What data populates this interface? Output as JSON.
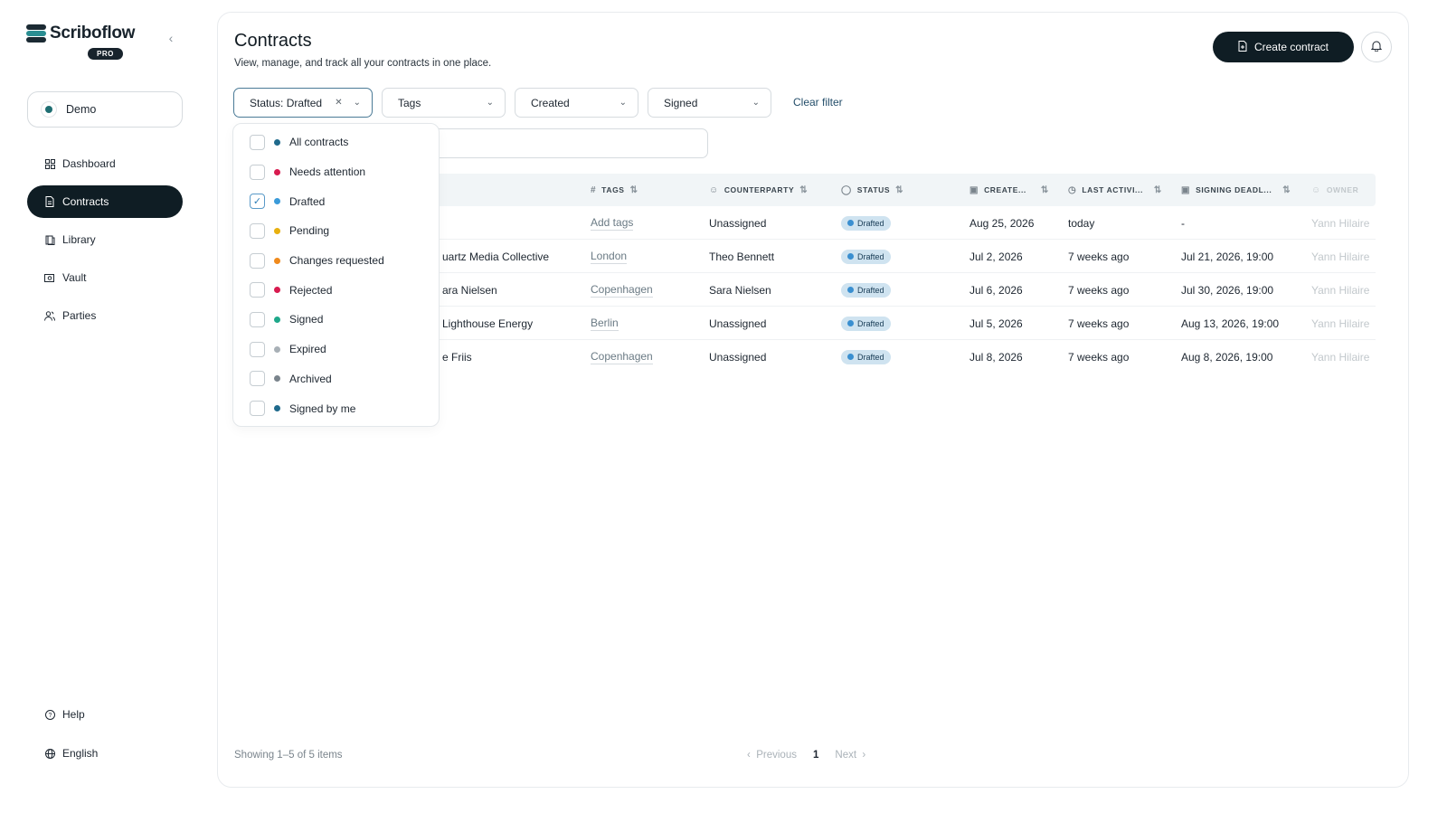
{
  "brand": {
    "name": "Scriboflow",
    "badge": "PRO"
  },
  "workspace": {
    "name": "Demo"
  },
  "nav": [
    {
      "label": "Dashboard",
      "icon": "grid-icon",
      "active": false
    },
    {
      "label": "Contracts",
      "icon": "document-icon",
      "active": true
    },
    {
      "label": "Library",
      "icon": "book-icon",
      "active": false
    },
    {
      "label": "Vault",
      "icon": "vault-icon",
      "active": false
    },
    {
      "label": "Parties",
      "icon": "users-icon",
      "active": false
    }
  ],
  "nav_bottom": [
    {
      "label": "Help",
      "icon": "help-icon"
    },
    {
      "label": "English",
      "icon": "globe-icon"
    }
  ],
  "header": {
    "title": "Contracts",
    "subtitle": "View, manage, and track all your contracts in one place.",
    "create_label": "Create contract"
  },
  "filters": {
    "status": "Status: Drafted",
    "tags": "Tags",
    "created": "Created",
    "signed": "Signed",
    "clear": "Clear filter"
  },
  "status_options": [
    {
      "label": "All contracts",
      "color": "#1f6a8c",
      "checked": false
    },
    {
      "label": "Needs attention",
      "color": "#d81b4f",
      "checked": false
    },
    {
      "label": "Drafted",
      "color": "#3a9ad9",
      "checked": true
    },
    {
      "label": "Pending",
      "color": "#e8b00f",
      "checked": false
    },
    {
      "label": "Changes requested",
      "color": "#f08a1c",
      "checked": false
    },
    {
      "label": "Rejected",
      "color": "#d81b4f",
      "checked": false
    },
    {
      "label": "Signed",
      "color": "#1fa88a",
      "checked": false
    },
    {
      "label": "Expired",
      "color": "#a8b0b6",
      "checked": false
    },
    {
      "label": "Archived",
      "color": "#7a848c",
      "checked": false
    },
    {
      "label": "Signed by me",
      "color": "#1f6a8c",
      "checked": false
    }
  ],
  "columns": {
    "tags": "TAGS",
    "counterparty": "COUNTERPARTY",
    "status": "STATUS",
    "created": "CREATE...",
    "last_activity": "LAST ACTIVI...",
    "signing_deadline": "SIGNING DEADL...",
    "owner": "OWNER"
  },
  "rows": [
    {
      "name": "",
      "tags": "Add tags",
      "counterparty": "Unassigned",
      "status": "Drafted",
      "created": "Aug 25, 2026",
      "last": "today",
      "deadline": "-",
      "owner": "Yann Hilaire"
    },
    {
      "name": "uartz Media Collective",
      "tags": "London",
      "counterparty": "Theo Bennett",
      "status": "Drafted",
      "created": "Jul 2, 2026",
      "last": "7 weeks ago",
      "deadline": "Jul 21, 2026, 19:00",
      "owner": "Yann Hilaire"
    },
    {
      "name": "ara Nielsen",
      "tags": "Copenhagen",
      "counterparty": "Sara Nielsen",
      "status": "Drafted",
      "created": "Jul 6, 2026",
      "last": "7 weeks ago",
      "deadline": "Jul 30, 2026, 19:00",
      "owner": "Yann Hilaire"
    },
    {
      "name": "Lighthouse Energy",
      "tags": "Berlin",
      "counterparty": "Unassigned",
      "status": "Drafted",
      "created": "Jul 5, 2026",
      "last": "7 weeks ago",
      "deadline": "Aug 13, 2026, 19:00",
      "owner": "Yann Hilaire"
    },
    {
      "name": "e Friis",
      "tags": "Copenhagen",
      "counterparty": "Unassigned",
      "status": "Drafted",
      "created": "Jul 8, 2026",
      "last": "7 weeks ago",
      "deadline": "Aug 8, 2026, 19:00",
      "owner": "Yann Hilaire"
    }
  ],
  "footer": {
    "info": "Showing 1–5 of 5 items",
    "previous": "Previous",
    "page": "1",
    "next": "Next"
  }
}
